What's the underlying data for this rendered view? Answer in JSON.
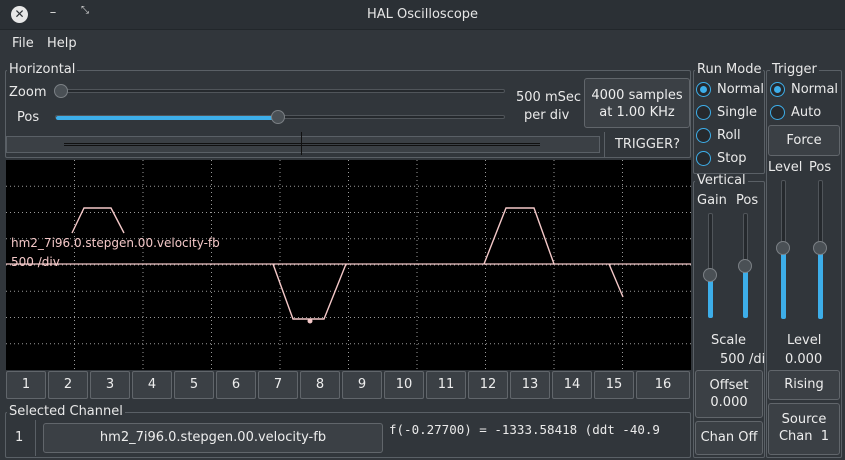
{
  "window": {
    "title": "HAL Oscilloscope",
    "close_glyph": "✕",
    "minimize_glyph": "–",
    "maximize_glyph": "⤡"
  },
  "menu": [
    {
      "label": "File"
    },
    {
      "label": "Help"
    }
  ],
  "horizontal": {
    "title": "Horizontal",
    "zoom_label": "Zoom",
    "zoom_value": 0.0,
    "pos_label": "Pos",
    "pos_value": 0.45,
    "rate_line1": "500 mSec",
    "rate_line2": "per div",
    "samples_line1": "4000 samples",
    "samples_line2": "at 1.00 KHz",
    "trigger_status": "TRIGGER?"
  },
  "scope": {
    "trace_name": "hm2_7i96.0.stepgen.00.velocity-fb",
    "trace_scale": "500 /div",
    "trace_color": "#f4c8c8",
    "grid_cols": 10,
    "grid_rows": 8
  },
  "channels": [
    "1",
    "2",
    "3",
    "4",
    "5",
    "6",
    "7",
    "8",
    "9",
    "10",
    "11",
    "12",
    "13",
    "14",
    "15",
    "16"
  ],
  "selected_channel": {
    "title": "Selected Channel",
    "number": "1",
    "name": "hm2_7i96.0.stepgen.00.velocity-fb",
    "readout": "f(-0.27700) = -1333.58418 (ddt -40.9"
  },
  "run_mode": {
    "title": "Run Mode",
    "options": [
      {
        "label": "Normal",
        "selected": true
      },
      {
        "label": "Single",
        "selected": false
      },
      {
        "label": "Roll",
        "selected": false
      },
      {
        "label": "Stop",
        "selected": false
      }
    ]
  },
  "vertical": {
    "title": "Vertical",
    "gain_label": "Gain",
    "pos_label": "Pos",
    "gain_value": 0.33,
    "pos_value": 0.5,
    "scale_label": "Scale",
    "scale_value": "500 /di",
    "offset_label": "Offset",
    "offset_value": "0.000",
    "chan_off_label": "Chan Off"
  },
  "trigger": {
    "title": "Trigger",
    "options": [
      {
        "label": "Normal",
        "selected": true
      },
      {
        "label": "Auto",
        "selected": false
      }
    ],
    "force_label": "Force",
    "level_label": "Level",
    "pos_label": "Pos",
    "level_slider": 0.5,
    "pos_slider": 0.5,
    "level_text_label": "Level",
    "level_value": "0.000",
    "edge_label": "Rising",
    "source_line1": "Source",
    "source_line2": "Chan  1"
  }
}
